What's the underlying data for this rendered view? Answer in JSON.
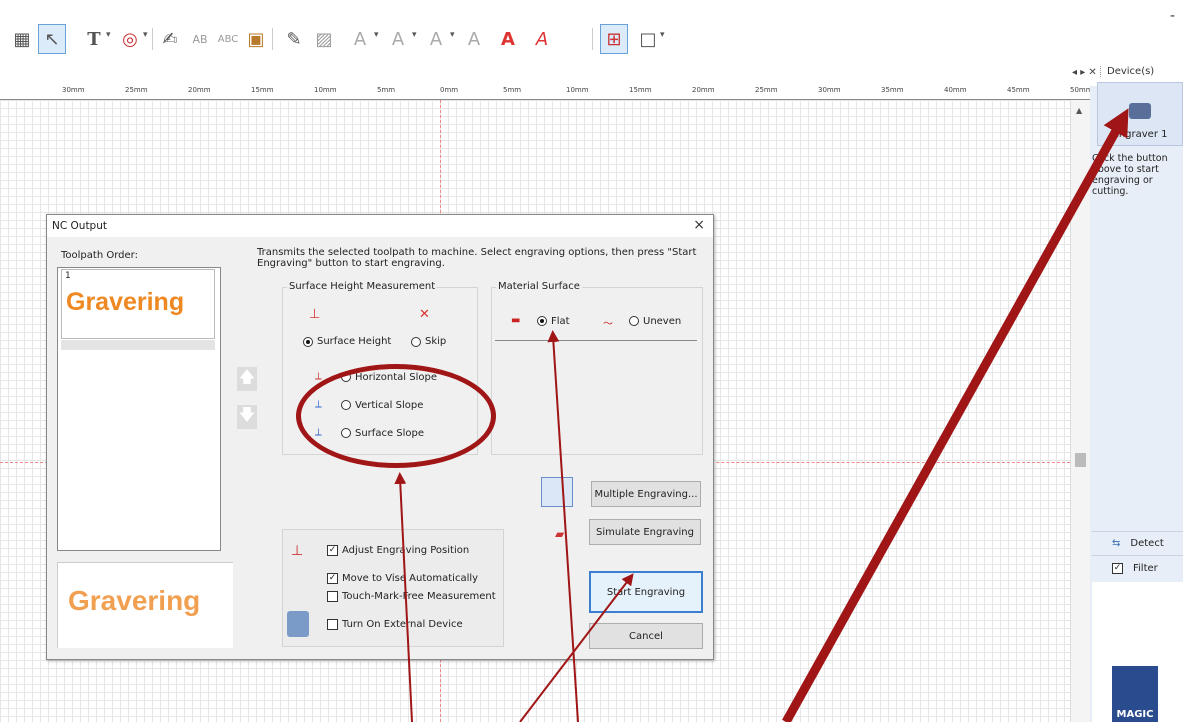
{
  "toolbar": {
    "buttons": [
      "layout-icon",
      "select-cursor-icon",
      "text-tool-icon",
      "circle-tool-icon",
      "pen-tool-icon",
      "text-ab-icon",
      "text-abc-icon",
      "stamp-icon",
      "edit-icon",
      "outline-a-icon",
      "shadow-a-icon",
      "emboss-a-icon",
      "fill-a-icon",
      "style-a-icon",
      "red-a-icon",
      "red-a-italic-icon",
      "grid-icon",
      "frame-icon"
    ],
    "text_tool": "T",
    "minimize": "-"
  },
  "ruler": {
    "ticks": [
      "30mm",
      "25mm",
      "20mm",
      "15mm",
      "10mm",
      "5mm",
      "0mm",
      "5mm",
      "10mm",
      "15mm",
      "20mm",
      "25mm",
      "30mm",
      "35mm",
      "40mm",
      "45mm",
      "50mm"
    ]
  },
  "panel": {
    "controls": "◂ ▸ ✕",
    "title": "Device(s)",
    "device_label": "Engraver 1",
    "hint": "Click the button above to start engraving or cutting.",
    "detect": "Detect",
    "filter": "Filter",
    "logo_text": "MAGIC"
  },
  "dialog": {
    "title": "NC Output",
    "close": "×",
    "toolpath_label": "Toolpath Order:",
    "toolpath_items": [
      {
        "index": "1",
        "text": "Gravering"
      }
    ],
    "preview_text": "Gravering",
    "description": "Transmits the selected toolpath to machine.  Select engraving options, then press \"Start Engraving\" button to start engraving.",
    "surface_group": "Surface Height Measurement",
    "surface_height": "Surface Height",
    "skip": "Skip",
    "horizontal_slope": "Horizontal Slope",
    "vertical_slope": "Vertical Slope",
    "surface_slope": "Surface Slope",
    "material_group": "Material Surface",
    "flat": "Flat",
    "uneven": "Uneven",
    "multiple_engraving": "Multiple Engraving...",
    "simulate_engraving": "Simulate Engraving",
    "adjust_position": "Adjust Engraving Position",
    "move_to_vise": "Move to Vise Automatically",
    "touch_mark_free": "Touch-Mark-Free Measurement",
    "external_device": "Turn On External Device",
    "start_engraving": "Start Engraving",
    "cancel": "Cancel"
  },
  "colors": {
    "annotation": "#a01515",
    "accent": "#3c7fd1",
    "preview_text": "#ee8822"
  }
}
